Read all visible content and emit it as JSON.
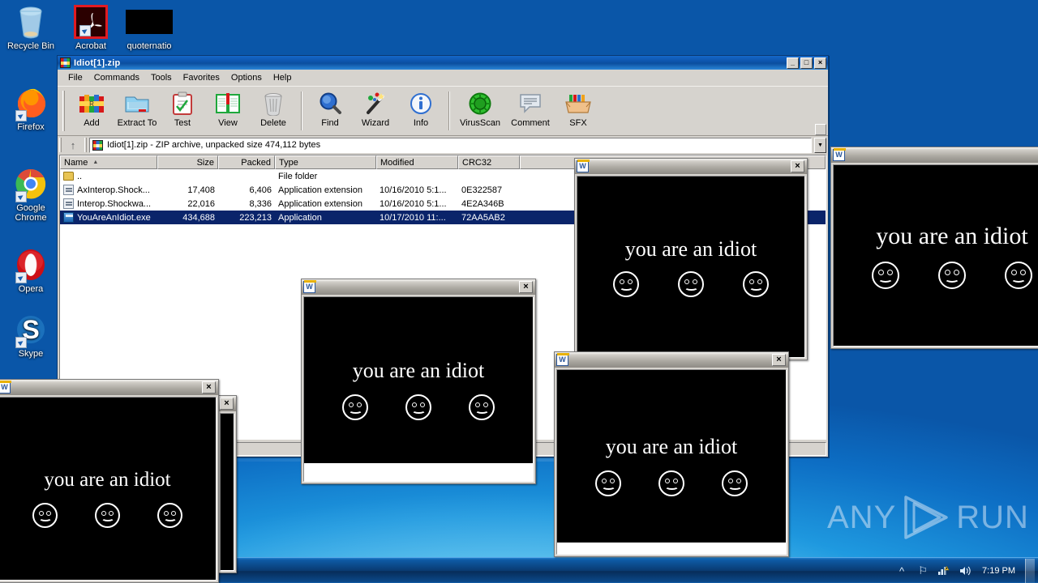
{
  "desktop": {
    "icons": [
      {
        "name": "recycle-bin",
        "label": "Recycle Bin"
      },
      {
        "name": "acrobat",
        "label": "Acrobat"
      },
      {
        "name": "quoternatio",
        "label": "quoternatio"
      },
      {
        "name": "firefox",
        "label": "Firefox"
      },
      {
        "name": "google-chrome",
        "label": "Google\nChrome"
      },
      {
        "name": "opera",
        "label": "Opera"
      },
      {
        "name": "skype",
        "label": "Skype"
      }
    ],
    "watermark": {
      "left": "ANY",
      "right": "RUN"
    }
  },
  "taskbar": {
    "clock": "7:19 PM",
    "tray": [
      "show-hidden-icons",
      "flag",
      "network-warning",
      "volume"
    ]
  },
  "winrar": {
    "title": "Idiot[1].zip",
    "menu": [
      "File",
      "Commands",
      "Tools",
      "Favorites",
      "Options",
      "Help"
    ],
    "toolbar": [
      {
        "id": "add",
        "label": "Add"
      },
      {
        "id": "extract-to",
        "label": "Extract To"
      },
      {
        "id": "test",
        "label": "Test"
      },
      {
        "id": "view",
        "label": "View"
      },
      {
        "id": "delete",
        "label": "Delete"
      },
      {
        "id": "find",
        "label": "Find"
      },
      {
        "id": "wizard",
        "label": "Wizard"
      },
      {
        "id": "info",
        "label": "Info"
      },
      {
        "id": "virusscan",
        "label": "VirusScan"
      },
      {
        "id": "comment",
        "label": "Comment"
      },
      {
        "id": "sfx",
        "label": "SFX"
      }
    ],
    "address": "Idiot[1].zip - ZIP archive, unpacked size 474,112 bytes",
    "columns": [
      "Name",
      "Size",
      "Packed",
      "Type",
      "Modified",
      "CRC32"
    ],
    "rows": [
      {
        "icon": "folder",
        "name": "..",
        "size": "",
        "packed": "",
        "type": "File folder",
        "modified": "",
        "crc": "",
        "selected": false
      },
      {
        "icon": "dll",
        "name": "AxInterop.Shock...",
        "size": "17,408",
        "packed": "6,406",
        "type": "Application extension",
        "modified": "10/16/2010 5:1...",
        "crc": "0E322587",
        "selected": false
      },
      {
        "icon": "dll",
        "name": "Interop.Shockwa...",
        "size": "22,016",
        "packed": "8,336",
        "type": "Application extension",
        "modified": "10/16/2010 5:1...",
        "crc": "4E2A346B",
        "selected": false
      },
      {
        "icon": "exe",
        "name": "YouAreAnIdiot.exe",
        "size": "434,688",
        "packed": "223,213",
        "type": "Application",
        "modified": "10/17/2010 11:...",
        "crc": "72AA5AB2",
        "selected": true
      }
    ],
    "buttons": {
      "minimize": "_",
      "maximize": "□",
      "close": "×"
    }
  },
  "popups": [
    {
      "id": "popup-top-right",
      "message": "you are an idiot",
      "close": "×"
    },
    {
      "id": "popup-top-center",
      "message": "you are an idiot",
      "close": "×"
    },
    {
      "id": "popup-center",
      "message": "you are an idiot",
      "close": "×"
    },
    {
      "id": "popup-bottom-right",
      "message": "you are an idiot",
      "close": "×"
    },
    {
      "id": "popup-bottom-left",
      "message": "you are an idiot",
      "close": "×"
    },
    {
      "id": "popup-hidden-left",
      "message": "",
      "close": "×"
    }
  ]
}
